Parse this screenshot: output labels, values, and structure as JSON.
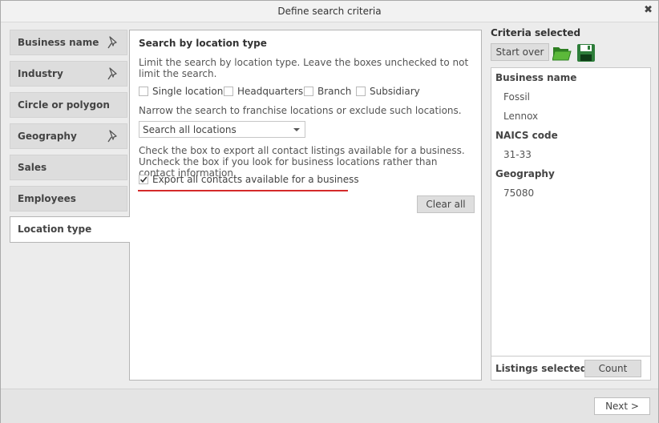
{
  "window": {
    "title": "Define search criteria",
    "close_glyph": "✖"
  },
  "nav": {
    "items": [
      {
        "label": "Business name",
        "has_pin": true
      },
      {
        "label": "Industry",
        "has_pin": true
      },
      {
        "label": "Circle or polygon",
        "has_pin": false
      },
      {
        "label": "Geography",
        "has_pin": true
      },
      {
        "label": "Sales",
        "has_pin": false
      },
      {
        "label": "Employees",
        "has_pin": false
      },
      {
        "label": "Location type",
        "has_pin": false,
        "active": true
      }
    ]
  },
  "panel": {
    "heading": "Search by location type",
    "limit_text": "Limit the search by location type. Leave the boxes unchecked to not limit the search.",
    "location_types": [
      {
        "label": "Single location",
        "checked": false
      },
      {
        "label": "Headquarters",
        "checked": false
      },
      {
        "label": "Branch",
        "checked": false
      },
      {
        "label": "Subsidiary",
        "checked": false
      }
    ],
    "franchise_text": "Narrow the search to franchise locations or exclude such locations.",
    "franchise_select": {
      "value": "Search all locations"
    },
    "export_text": "Check the box to export all contact listings available for a business. Uncheck the box if you look for business locations rather than contact information.",
    "export_checkbox": {
      "label": "Export all contacts available for a business",
      "checked": true
    },
    "clear_all_label": "Clear all"
  },
  "criteria": {
    "title": "Criteria selected",
    "start_over_label": "Start over",
    "open_icon": "folder-open-icon",
    "save_icon": "floppy-disk-icon",
    "groups": [
      {
        "heading": "Business name",
        "values": [
          "Fossil",
          "Lennox"
        ]
      },
      {
        "heading": "NAICS code",
        "values": [
          "31-33"
        ]
      },
      {
        "heading": "Geography",
        "values": [
          "75080"
        ]
      }
    ],
    "listings_label": "Listings selected:",
    "count_label": "Count"
  },
  "footer": {
    "next_label": "Next >"
  },
  "colors": {
    "accent_underline": "#d42a2a",
    "folder_green": "#3f9a2b",
    "disk_green": "#2d7d3a"
  }
}
